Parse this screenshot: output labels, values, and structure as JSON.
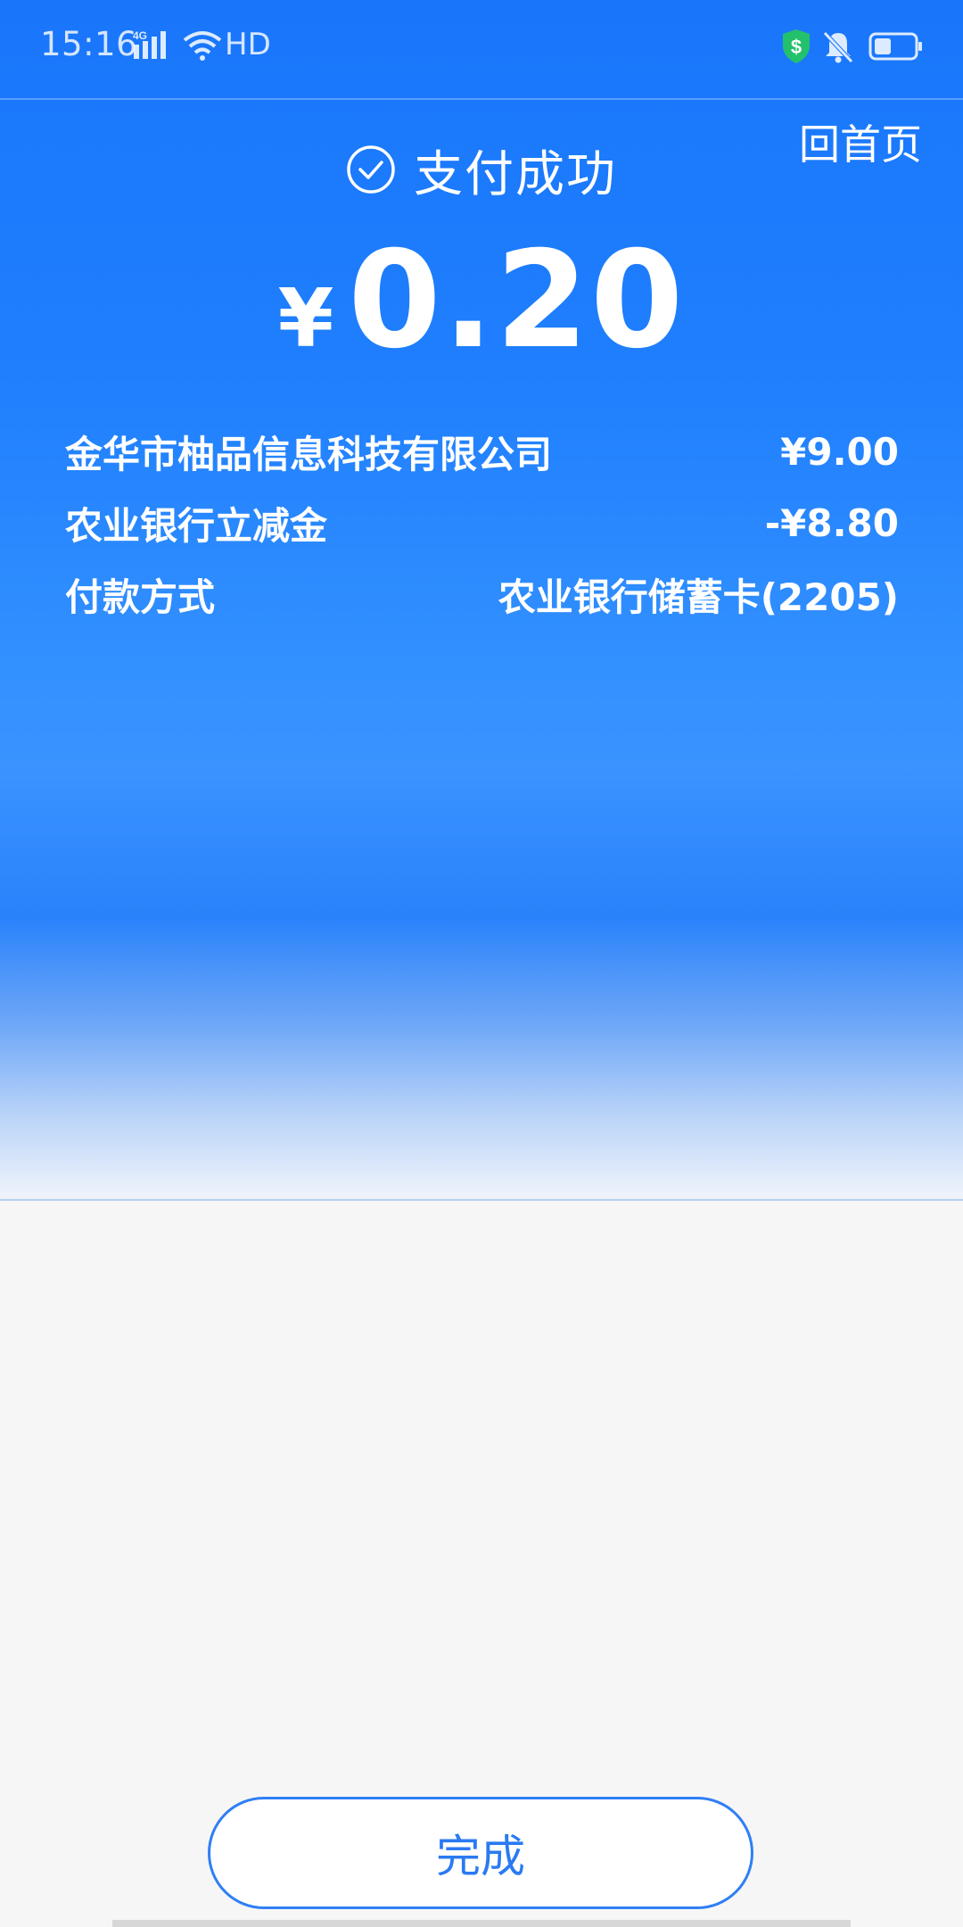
{
  "status_bar": {
    "time": "15:16",
    "network_type": "4G",
    "hd_label": "HD",
    "icons": [
      "signal-icon",
      "wifi-icon",
      "security-shield-icon",
      "mute-icon",
      "battery-icon"
    ]
  },
  "header": {
    "home_link": "回首页"
  },
  "result": {
    "title": "支付成功",
    "currency_symbol": "¥",
    "amount": "0.20"
  },
  "details": [
    {
      "label": "金华市柚品信息科技有限公司",
      "value": "¥9.00"
    },
    {
      "label": "农业银行立减金",
      "value": "-¥8.80"
    },
    {
      "label": "付款方式",
      "value": "农业银行储蓄卡(2205)"
    }
  ],
  "footer": {
    "done_label": "完成"
  },
  "colors": {
    "brand_blue": "#1976fb",
    "button_text": "#2a7af2",
    "shield_green": "#23c16b"
  }
}
